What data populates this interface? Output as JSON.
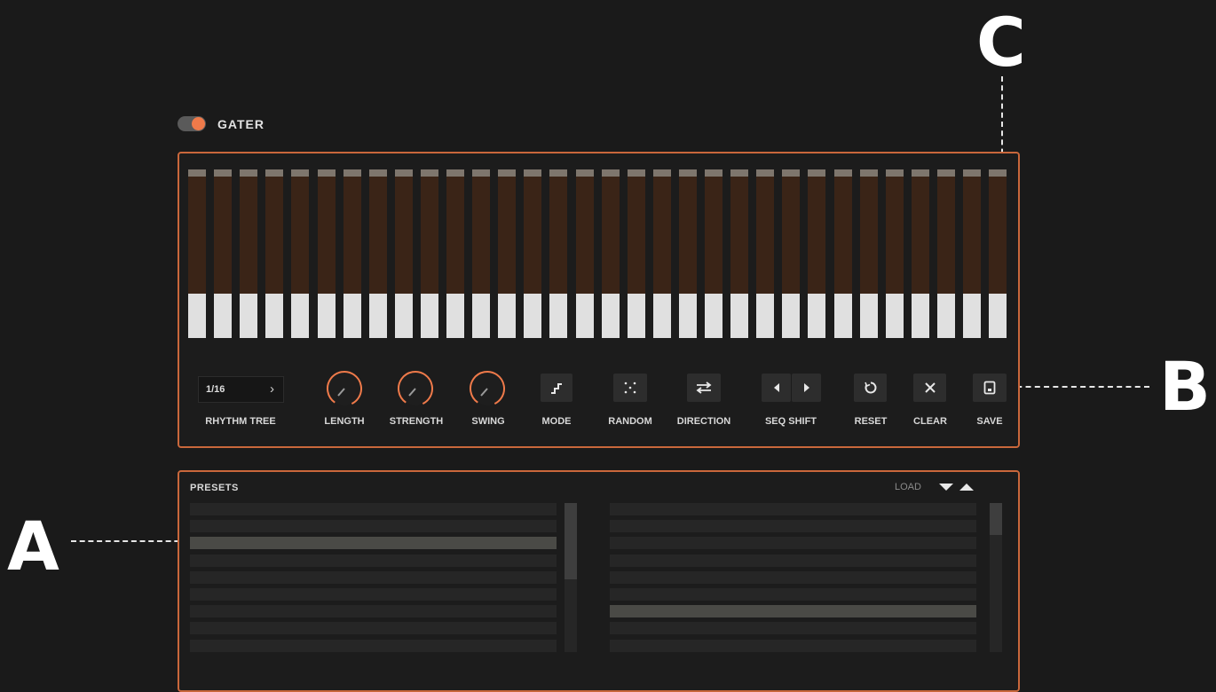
{
  "plugin": {
    "title": "GATER",
    "enabled": true
  },
  "callouts": {
    "a": "A",
    "b": "B",
    "c": "C"
  },
  "sequencer": {
    "step_count": 32
  },
  "controls": {
    "rhythm_tree": {
      "value": "1/16",
      "label": "RHYTHM TREE"
    },
    "length": {
      "label": "LENGTH"
    },
    "strength": {
      "label": "STRENGTH"
    },
    "swing": {
      "label": "SWING"
    },
    "mode": {
      "label": "MODE",
      "icon": "step-mode-icon"
    },
    "random": {
      "label": "RANDOM",
      "icon": "dice-icon"
    },
    "direction": {
      "label": "DIRECTION",
      "icon": "swap-arrows-icon"
    },
    "seq_shift": {
      "label": "SEQ SHIFT",
      "icons": [
        "shift-left-icon",
        "shift-right-icon"
      ]
    },
    "reset": {
      "label": "RESET",
      "icon": "reset-icon"
    },
    "clear": {
      "label": "CLEAR",
      "icon": "close-icon"
    },
    "save": {
      "label": "SAVE",
      "icon": "save-icon"
    }
  },
  "presets": {
    "title": "PRESETS",
    "load_label": "LOAD",
    "left_list": {
      "rows": 9,
      "selected_index": 2
    },
    "right_list": {
      "rows": 9,
      "selected_index": 6
    }
  },
  "colors": {
    "accent": "#ef7a4a",
    "panel_border": "#c9673b",
    "background": "#1a1a1a",
    "step_body": "#3a2417",
    "gate_on": "#e0e0e0"
  }
}
